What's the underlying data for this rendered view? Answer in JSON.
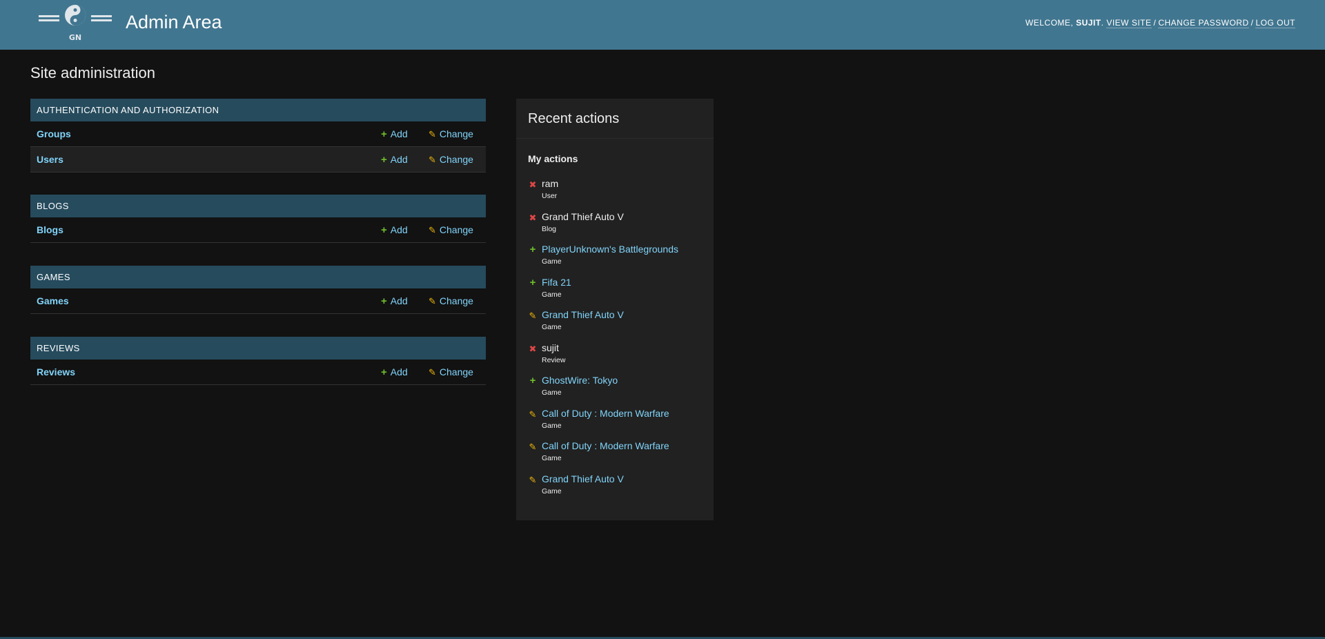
{
  "header": {
    "logo_text": "GN",
    "title": "Admin Area",
    "welcome": "Welcome,",
    "username": "sujit",
    "view_site": "View site",
    "change_password": "Change password",
    "log_out": "Log out",
    "separator": "/"
  },
  "content": {
    "title": "Site administration"
  },
  "modules": [
    {
      "caption": "Authentication and Authorization",
      "models": [
        {
          "name": "Groups",
          "add": "Add",
          "change": "Change"
        },
        {
          "name": "Users",
          "add": "Add",
          "change": "Change"
        }
      ]
    },
    {
      "caption": "Blogs",
      "models": [
        {
          "name": "Blogs",
          "add": "Add",
          "change": "Change"
        }
      ]
    },
    {
      "caption": "Games",
      "models": [
        {
          "name": "Games",
          "add": "Add",
          "change": "Change"
        }
      ]
    },
    {
      "caption": "Reviews",
      "models": [
        {
          "name": "Reviews",
          "add": "Add",
          "change": "Change"
        }
      ]
    }
  ],
  "recent": {
    "title": "Recent actions",
    "subtitle": "My actions",
    "actions": [
      {
        "kind": "delete",
        "icon": "delete-icon",
        "object": "ram",
        "type": "User"
      },
      {
        "kind": "delete",
        "icon": "delete-icon",
        "object": "Grand Thief Auto V",
        "type": "Blog"
      },
      {
        "kind": "add",
        "icon": "add-icon",
        "object": "PlayerUnknown's Battlegrounds",
        "type": "Game"
      },
      {
        "kind": "add",
        "icon": "add-icon",
        "object": "Fifa 21",
        "type": "Game"
      },
      {
        "kind": "change",
        "icon": "change-icon",
        "object": "Grand Thief Auto V",
        "type": "Game"
      },
      {
        "kind": "delete",
        "icon": "delete-icon",
        "object": "sujit",
        "type": "Review"
      },
      {
        "kind": "add",
        "icon": "add-icon",
        "object": "GhostWire: Tokyo",
        "type": "Game"
      },
      {
        "kind": "change",
        "icon": "change-icon",
        "object": "Call of Duty : Modern Warfare",
        "type": "Game"
      },
      {
        "kind": "change",
        "icon": "change-icon",
        "object": "Call of Duty : Modern Warfare",
        "type": "Game"
      },
      {
        "kind": "change",
        "icon": "change-icon",
        "object": "Grand Thief Auto V",
        "type": "Game"
      }
    ]
  },
  "colors": {
    "header_bg": "#417690",
    "module_caption_bg": "#264b5d",
    "link": "#81d4fa",
    "add_icon": "#70bf2b",
    "change_icon": "#efb80b",
    "delete_icon": "#dd4646",
    "page_bg": "#121212"
  }
}
